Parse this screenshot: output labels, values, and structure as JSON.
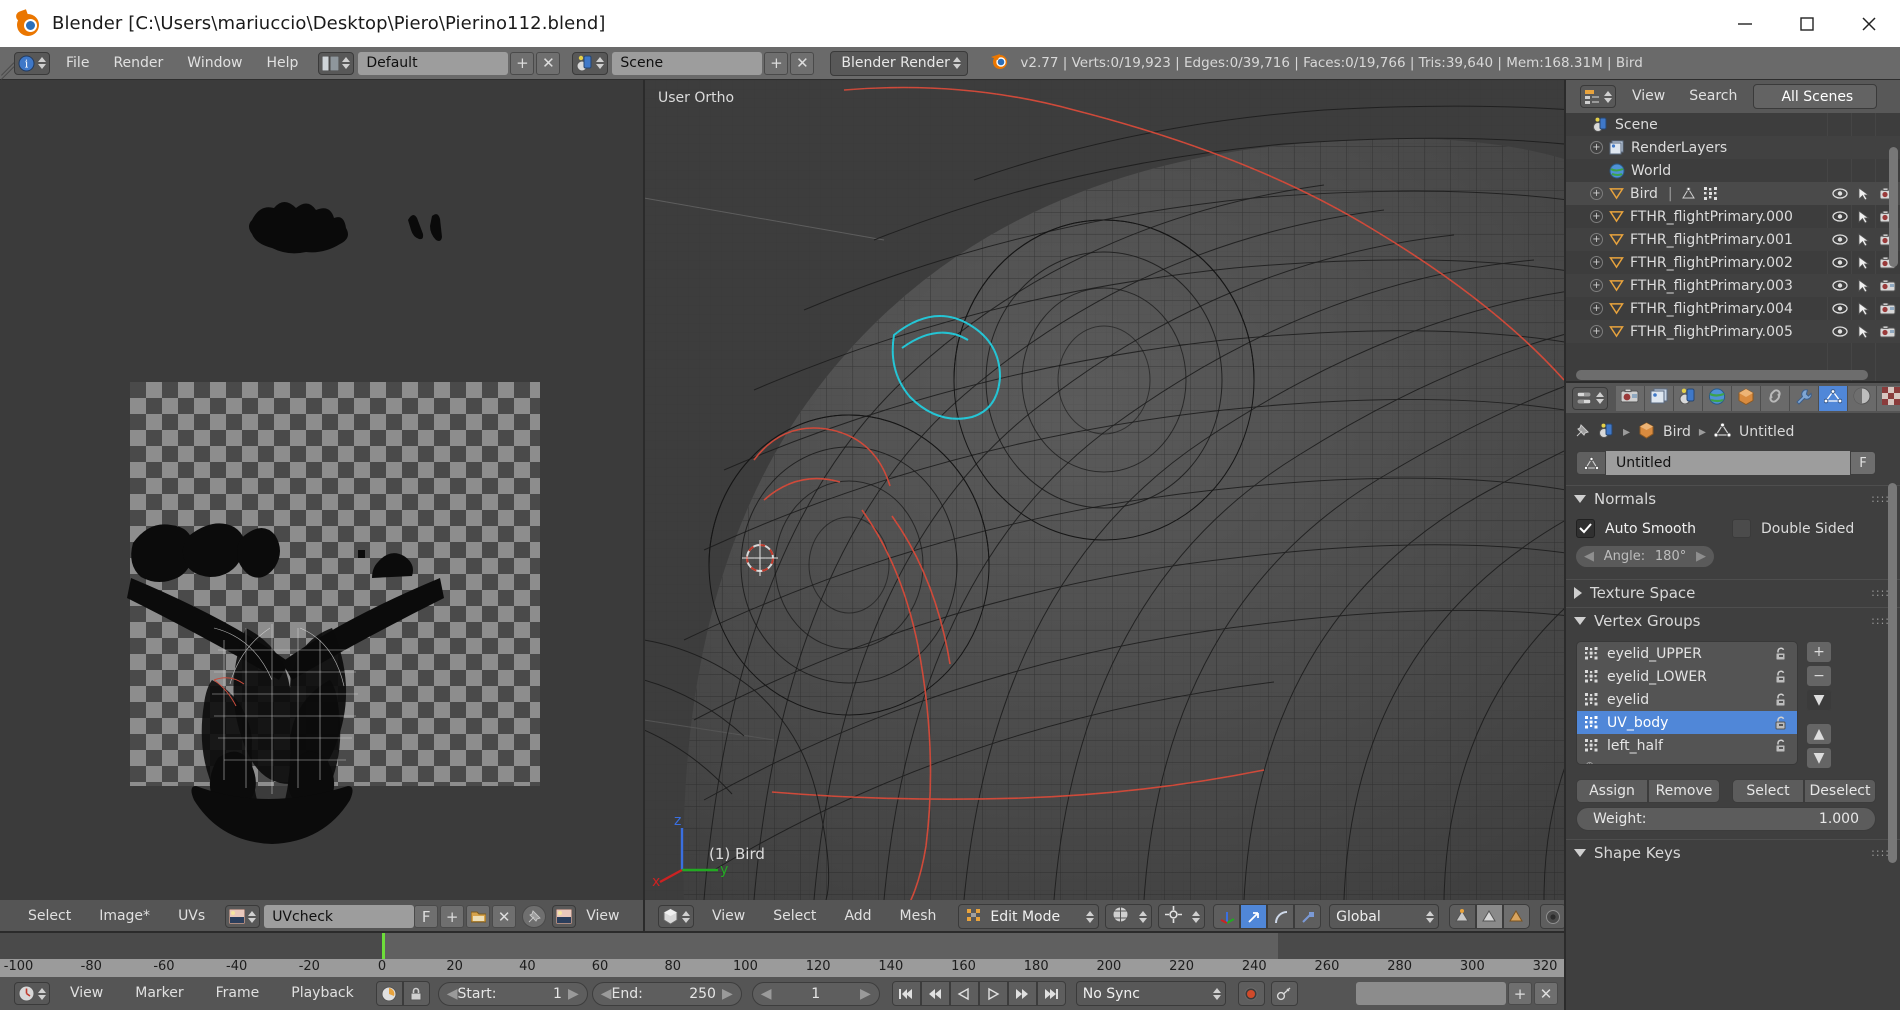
{
  "window": {
    "title": "Blender [C:\\Users\\mariuccio\\Desktop\\Piero\\Pierino112.blend]",
    "minimize": "—",
    "maximize": "☐",
    "close": "✕"
  },
  "info_header": {
    "editor_icon": "info-editor-icon",
    "menus": [
      "File",
      "Render",
      "Window",
      "Help"
    ],
    "screen_layout_icon": "screen-layout-icon",
    "screen_layout": "Default",
    "add_label": "+",
    "delete_label": "✕",
    "scene_icon": "scene-icon",
    "scene": "Scene",
    "engine": "Blender Render",
    "blender_icon": "blender-logo-icon",
    "stats": "v2.77 | Verts:0/19,923 | Edges:0/39,716 | Faces:0/19,766 | Tris:39,640 | Mem:168.31M | Bird"
  },
  "outliner": {
    "editor_icon": "outliner-editor-icon",
    "menus": [
      "View",
      "Search"
    ],
    "display_mode": "All Scenes",
    "rows": [
      {
        "label": "Scene",
        "indent": 0,
        "icon": "scene-icon",
        "expand": false,
        "cols": false
      },
      {
        "label": "RenderLayers",
        "indent": 1,
        "icon": "renderlayer-icon",
        "expand": true,
        "cols": false
      },
      {
        "label": "World",
        "indent": 1,
        "icon": "world-icon",
        "expand": false,
        "cols": false
      },
      {
        "label": "Bird",
        "indent": 1,
        "icon": "mesh-icon",
        "expand": true,
        "cols": true,
        "selected": true
      },
      {
        "label": "FTHR_flightPrimary.000",
        "indent": 1,
        "icon": "mesh-icon",
        "expand": true,
        "cols": true
      },
      {
        "label": "FTHR_flightPrimary.001",
        "indent": 1,
        "icon": "mesh-icon",
        "expand": true,
        "cols": true
      },
      {
        "label": "FTHR_flightPrimary.002",
        "indent": 1,
        "icon": "mesh-icon",
        "expand": true,
        "cols": true
      },
      {
        "label": "FTHR_flightPrimary.003",
        "indent": 1,
        "icon": "mesh-icon",
        "expand": true,
        "cols": true
      },
      {
        "label": "FTHR_flightPrimary.004",
        "indent": 1,
        "icon": "mesh-icon",
        "expand": true,
        "cols": true
      },
      {
        "label": "FTHR_flightPrimary.005",
        "indent": 1,
        "icon": "mesh-icon",
        "expand": true,
        "cols": true
      }
    ],
    "col_icons": [
      "eye-icon",
      "cursor-arrow-icon",
      "camera-icon"
    ]
  },
  "properties": {
    "tabs": [
      {
        "name": "render-tab",
        "icon": "camera-back-icon",
        "active": false
      },
      {
        "name": "render-layers-tab",
        "icon": "images-icon",
        "active": false
      },
      {
        "name": "scene-tab",
        "icon": "scene-icon",
        "active": false
      },
      {
        "name": "world-tab",
        "icon": "world-globe-icon",
        "active": false
      },
      {
        "name": "object-tab",
        "icon": "cube-icon",
        "active": false
      },
      {
        "name": "constraints-tab",
        "icon": "chain-link-icon",
        "active": false
      },
      {
        "name": "modifiers-tab",
        "icon": "wrench-icon",
        "active": false
      },
      {
        "name": "data-tab",
        "icon": "mesh-data-icon",
        "active": true
      },
      {
        "name": "material-tab",
        "icon": "material-sphere-icon",
        "active": false
      },
      {
        "name": "texture-tab",
        "icon": "checker-texture-icon",
        "active": false
      }
    ],
    "breadcrumb": {
      "pin_icon": "pin-icon",
      "scene_icon": "scene-icon",
      "object": "Bird",
      "object_icon": "cube-icon",
      "data": "Untitled",
      "data_icon": "mesh-data-icon",
      "sep": "▸"
    },
    "datablock": {
      "icon": "mesh-data-icon",
      "value": "Untitled",
      "fake_user": "F"
    },
    "normals": {
      "title": "Normals",
      "auto_smooth": {
        "label": "Auto Smooth",
        "checked": true
      },
      "double_sided": {
        "label": "Double Sided",
        "checked": false
      },
      "angle": {
        "label": "Angle:",
        "value": "180°"
      }
    },
    "texture_space": {
      "title": "Texture Space",
      "open": false
    },
    "vertex_groups": {
      "title": "Vertex Groups",
      "items": [
        {
          "label": "eyelid_UPPER",
          "selected": false
        },
        {
          "label": "eyelid_LOWER",
          "selected": false
        },
        {
          "label": "eyelid",
          "selected": false
        },
        {
          "label": "UV_body",
          "selected": true
        },
        {
          "label": "left_half",
          "selected": false
        }
      ],
      "side_buttons": [
        "+",
        "−",
        "▼"
      ],
      "move_buttons": [
        "▲",
        "▼"
      ],
      "buttons": [
        "Assign",
        "Remove",
        "Select",
        "Deselect"
      ],
      "weight": {
        "label": "Weight:",
        "value": "1.000"
      }
    },
    "shape_keys": {
      "title": "Shape Keys",
      "open": true
    }
  },
  "uv_editor": {
    "menus": [
      "Select",
      "Image*",
      "UVs"
    ],
    "image_icon": "image-icon",
    "image_name": "UVcheck",
    "fake_user": "F",
    "new_label": "+",
    "open_icon": "folder-open-icon",
    "unlink_label": "✕",
    "pin_icon": "pin-icon"
  },
  "view3d": {
    "view_name": "User Ortho",
    "object_label": "(1) Bird",
    "axis_labels": {
      "x": "x",
      "y": "y",
      "z": "z"
    },
    "editor_icon": "view3d-editor-icon",
    "menus": [
      "View",
      "Select",
      "Add",
      "Mesh"
    ],
    "mode": "Edit Mode",
    "mode_icon": "edit-mode-icon",
    "shading": "shading-solid-icon",
    "pivot": "pivot-median-icon",
    "toggles": [
      "manipulator-axis-icon",
      "manipulator-translate-icon",
      "manipulator-rotate-icon",
      "manipulator-scale-icon"
    ],
    "orientation": "Global",
    "select_modes": [
      "vertex-select-icon",
      "edge-select-icon",
      "face-select-icon"
    ],
    "occlude_icon": "limit-selection-icon"
  },
  "timeline": {
    "editor_icon": "timeline-editor-icon",
    "menus": [
      "View",
      "Marker",
      "Frame",
      "Playback"
    ],
    "auto_key_icon": "record-auto-key-icon",
    "lock_icon": "lock-icon",
    "start": {
      "label": "Start:",
      "value": "1"
    },
    "end": {
      "label": "End:",
      "value": "250"
    },
    "current_frame": "1",
    "nav_buttons": [
      "jump-start-icon",
      "step-back-icon",
      "play-reverse-icon",
      "play-icon",
      "step-forward-icon",
      "jump-end-icon"
    ],
    "sync_mode": "No Sync",
    "record_icon": "record-icon",
    "keying_set_icon": "keying-set-icon",
    "ruler_ticks": [
      "-100",
      "-80",
      "-60",
      "-40",
      "-20",
      "0",
      "20",
      "40",
      "60",
      "80",
      "100",
      "120",
      "140",
      "160",
      "180",
      "200",
      "220",
      "240",
      "260",
      "280",
      "300",
      "320"
    ],
    "playhead_frame": "1"
  },
  "colors": {
    "accent_blue": "#5087d8",
    "orange": "#ea7600",
    "playhead_green": "#6ddd3a",
    "header_gray": "#555555",
    "panel_gray": "#3f3f3f"
  }
}
